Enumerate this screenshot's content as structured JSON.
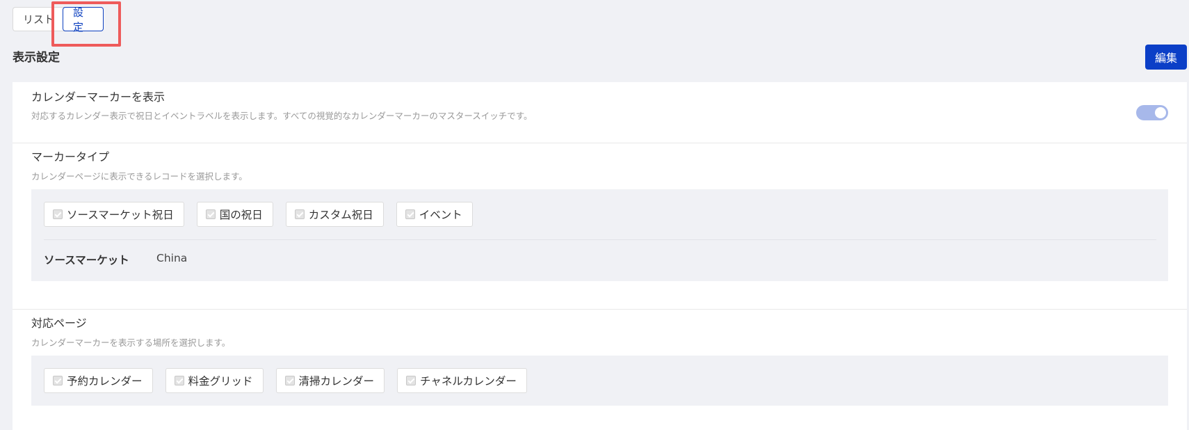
{
  "tabs": [
    {
      "label": "リスト",
      "active": false
    },
    {
      "label": "設定",
      "active": true
    }
  ],
  "page": {
    "title": "表示設定",
    "edit_label": "編集"
  },
  "calendar_marker": {
    "title": "カレンダーマーカーを表示",
    "description": "対応するカレンダー表示で祝日とイベントラベルを表示します。すべての視覚的なカレンダーマーカーのマスタースイッチです。",
    "enabled": true
  },
  "marker_type": {
    "title": "マーカータイプ",
    "description": "カレンダーページに表示できるレコードを選択します。",
    "options": [
      {
        "label": "ソースマーケット祝日",
        "checked": true
      },
      {
        "label": "国の祝日",
        "checked": true
      },
      {
        "label": "カスタム祝日",
        "checked": true
      },
      {
        "label": "イベント",
        "checked": true
      }
    ],
    "source_market_label": "ソースマーケット",
    "source_market_value": "China"
  },
  "supported_pages": {
    "title": "対応ページ",
    "description": "カレンダーマーカーを表示する場所を選択します。",
    "options": [
      {
        "label": "予約カレンダー",
        "checked": true
      },
      {
        "label": "料金グリッド",
        "checked": true
      },
      {
        "label": "清掃カレンダー",
        "checked": true
      },
      {
        "label": "チャネルカレンダー",
        "checked": true
      }
    ]
  },
  "colors": {
    "primary": "#0b3fc7",
    "highlight": "#ee5b5b",
    "toggle_on": "#a7b8ea",
    "background": "#f0f1f5"
  }
}
